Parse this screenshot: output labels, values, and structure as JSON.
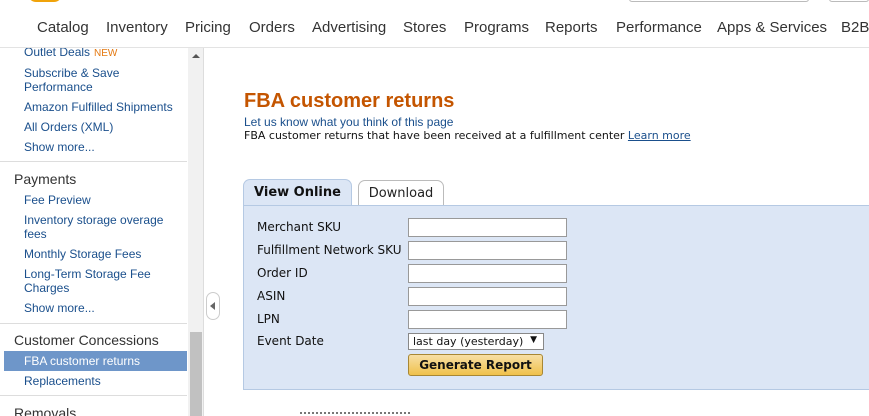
{
  "nav": {
    "items": [
      "Catalog",
      "Inventory",
      "Pricing",
      "Orders",
      "Advertising",
      "Stores",
      "Programs",
      "Reports",
      "Performance",
      "Apps & Services",
      "B2B"
    ]
  },
  "sidebar": {
    "orders_links": [
      {
        "label": "Outlet Deals",
        "badge": "NEW"
      },
      {
        "label": "Subscribe & Save Performance"
      },
      {
        "label": "Amazon Fulfilled Shipments"
      },
      {
        "label": "All Orders (XML)"
      },
      {
        "label": "Show more..."
      }
    ],
    "payments": {
      "title": "Payments",
      "links": [
        "Fee Preview",
        "Inventory storage overage fees",
        "Monthly Storage Fees",
        "Long-Term Storage Fee Charges",
        "Show more..."
      ]
    },
    "customer_concessions": {
      "title": "Customer Concessions",
      "links": [
        "FBA customer returns",
        "Replacements"
      ]
    },
    "removals": {
      "title": "Removals"
    }
  },
  "main": {
    "title": "FBA customer returns",
    "feedback_link": "Let us know what you think of this page",
    "description": "FBA customer returns that have been received at a fulfillment center",
    "learn_more": "Learn more",
    "tabs": [
      "View Online",
      "Download"
    ],
    "active_tab": "View Online"
  },
  "form": {
    "fields": [
      {
        "label": "Merchant SKU",
        "value": ""
      },
      {
        "label": "Fulfillment Network SKU",
        "value": ""
      },
      {
        "label": "Order ID",
        "value": ""
      },
      {
        "label": "ASIN",
        "value": ""
      },
      {
        "label": "LPN",
        "value": ""
      }
    ],
    "event_date_label": "Event Date",
    "event_date_value": "last day (yesterday)",
    "generate_button": "Generate Report"
  },
  "colors": {
    "title": "#c45500",
    "link": "#1a4f8c",
    "panel": "#dce6f5",
    "selected": "#6e96c9",
    "button": "#f0c14b"
  }
}
